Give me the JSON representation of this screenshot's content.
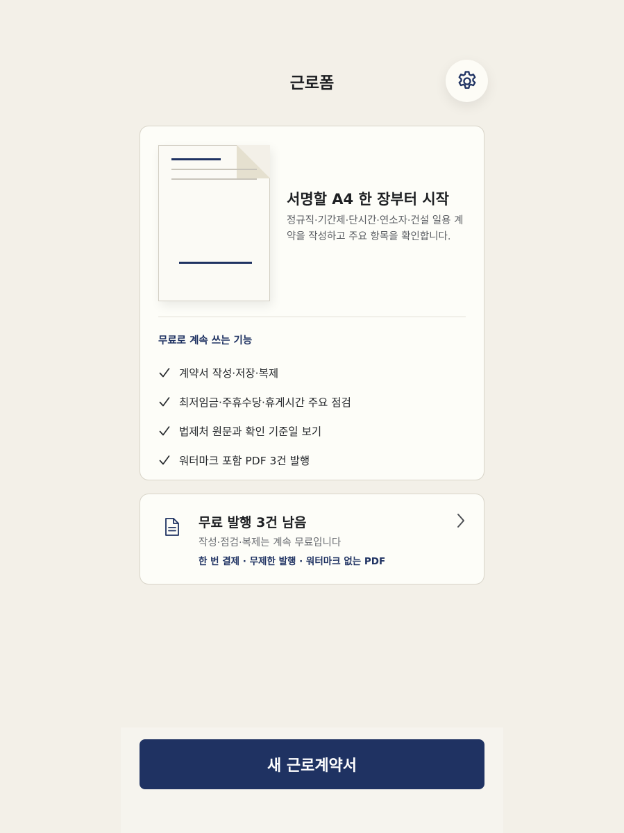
{
  "header": {
    "title": "근로폼",
    "settings_icon": "gear-icon"
  },
  "hero": {
    "title": "서명할 A4 한 장부터 시작",
    "description": "정규직·기간제·단시간·연소자·건설 일용 계약을 작성하고 주요 항목을 확인합니다.",
    "features_heading": "무료로 계속 쓰는 기능",
    "features": [
      "계약서 작성·저장·복제",
      "최저임금·주휴수당·휴게시간 주요 점검",
      "법제처 원문과 확인 기준일 보기",
      "워터마크 포함 PDF 3건 발행"
    ]
  },
  "issue_card": {
    "title": "무료 발행 3건 남음",
    "subtitle": "작성·점검·복제는 계속 무료입니다",
    "promo": "한 번 결제 · 무제한 발행 · 워터마크 없는 PDF",
    "icon": "document-icon",
    "chevron": "chevron-right-icon"
  },
  "primary_action": {
    "label": "새 근로계약서"
  },
  "colors": {
    "background": "#f3f0e8",
    "card": "#fdfdf8",
    "accent": "#1f3262",
    "text": "#1d1f22"
  }
}
